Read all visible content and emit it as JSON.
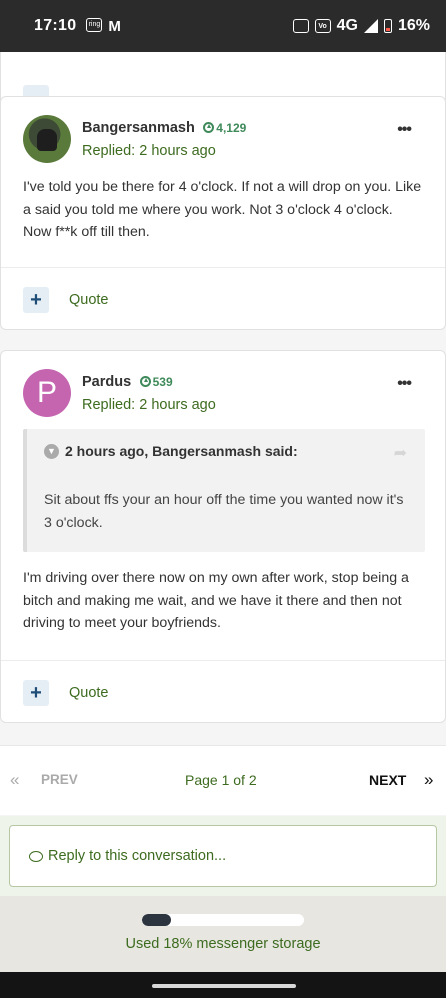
{
  "status_bar": {
    "time": "17:10",
    "network": "4G",
    "battery": "16%",
    "left_icons": [
      "ring-notification-icon",
      "gmail-icon"
    ],
    "right_icons": [
      "nfc-icon",
      "volte-icon",
      "signal-icon",
      "battery-icon"
    ]
  },
  "posts": [
    {
      "username": "Bangersanmash",
      "reputation": "4,129",
      "replied": "Replied: 2 hours ago",
      "avatar": "photo",
      "body": "I've told you be there for 4 o'clock. If not a will drop on you. Like a said you told me where you work. Not 3 o'clock 4 o'clock. Now f**k off till then.",
      "quote_label": "Quote"
    },
    {
      "username": "Pardus",
      "reputation": "539",
      "replied": "Replied: 2 hours ago",
      "avatar_letter": "P",
      "avatar_color": "#c565b0",
      "quote": {
        "header": "2 hours ago, Bangersanmash said:",
        "text": "Sit about ffs your an hour off the time you wanted now it's 3 o'clock."
      },
      "body": "I'm driving over there now on my own after work, stop being a bitch and making me wait, and we have it there and then not driving to meet your boyfriends.",
      "quote_label": "Quote"
    }
  ],
  "pagination": {
    "prev_label": "PREV",
    "page_info": "Page 1 of 2",
    "next_label": "NEXT",
    "prev_arrow": "«",
    "next_arrow": "»"
  },
  "reply": {
    "placeholder": "Reply to this conversation..."
  },
  "storage": {
    "used_fraction": 0.18,
    "label": "Used 18% messenger storage"
  },
  "colors": {
    "accent_green": "#3d6b1f",
    "reputation_green": "#3f8a5a",
    "quote_button_bg": "#e6eef5"
  }
}
